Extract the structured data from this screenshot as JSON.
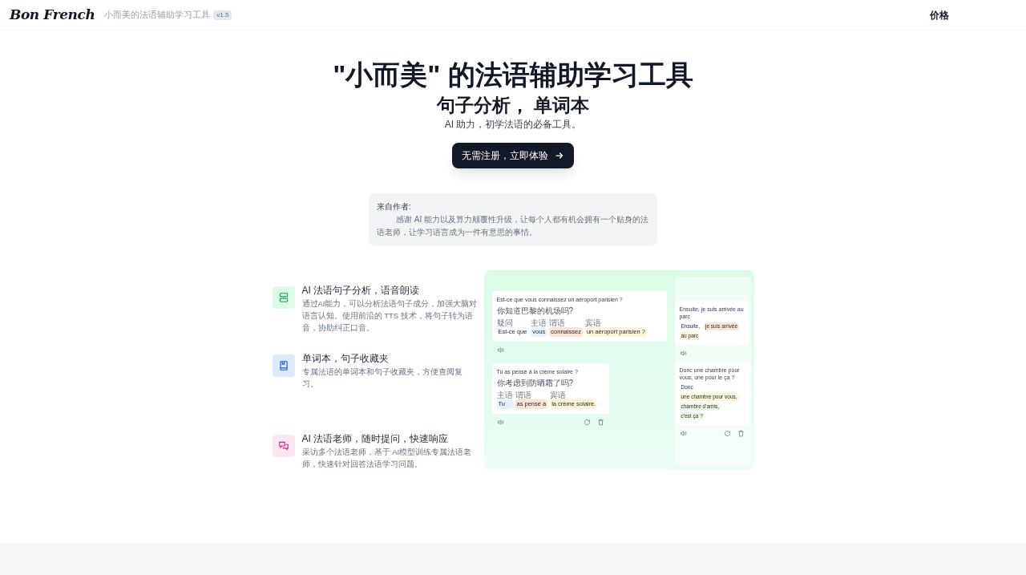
{
  "header": {
    "logo": "Bon French",
    "tagline": "小而美的法语辅助学习工具",
    "version": "v1.5",
    "nav": [
      {
        "label": "价格"
      }
    ]
  },
  "hero": {
    "title": "\"小而美\" 的法语辅助学习工具",
    "subtitle": "句子分析， 单词本",
    "description": "AI 助力，初学法语的必备工具。",
    "cta": "无需注册，立即体验"
  },
  "author_note": {
    "heading": "来自作者:",
    "body": "感谢 AI 能力以及算力颠覆性升级，让每个人都有机会拥有一个贴身的法语老师，让学习语言成为一件有意思的事情。"
  },
  "features": [
    {
      "kind": "analysis",
      "title": "AI 法语句子分析，语音朗读",
      "description": "通过AI能力，可以分析法语句子成分，加强大脑对语言认知。使用前沿的 TTS 技术，将句子转为语音，协助纠正口音。"
    },
    {
      "kind": "notebook",
      "title": "单词本，句子收藏夹",
      "description": "专属法语的单词本和句子收藏夹，方便查阅复习。"
    },
    {
      "kind": "chat",
      "title": "AI 法语老师，随时提问，快速响应",
      "description": "采访多个法语老师，基于 AI模型训练专属法语老师，快速针对回答法语学习问题。"
    }
  ],
  "preview": {
    "left_cards": [
      {
        "sentence": "Est-ce que vous connaissez un aéroport parisien ?",
        "translation": "你知道巴黎的机场吗?",
        "history_actions": false,
        "segments": [
          {
            "role": "疑问",
            "text": "Est-ce que",
            "color": "#ffffff"
          },
          {
            "role": "主语",
            "text": "vous",
            "color": "#e6f1fd"
          },
          {
            "role": "谓语",
            "text": "connaissez",
            "color": "#fde3d3"
          },
          {
            "role": "宾语",
            "text": "un aéroport parisien ?",
            "color": "#fef5d9"
          }
        ]
      },
      {
        "sentence": "Tu as pensé à la crème solaire ?",
        "translation": "你考虑到防晒霜了吗?",
        "history_actions": true,
        "segments": [
          {
            "role": "主语",
            "text": "Tu",
            "color": "#e6f1fd"
          },
          {
            "role": "谓语",
            "text": "as pensé à",
            "color": "#fde3d3"
          },
          {
            "role": "宾语",
            "text": "la crème solaire.",
            "color": "#fef5d9"
          }
        ]
      }
    ],
    "right_cards": [
      {
        "sentence": "Ensuite, je suis arrivée au parc",
        "history_actions": false,
        "segments": [
          {
            "text": "Ensuite,",
            "color": "#ffffff"
          },
          {
            "text": "je suis arrivée",
            "color": "#fde3d3"
          },
          {
            "text": "au parc",
            "color": "#fef5d9"
          }
        ]
      },
      {
        "sentence": "Donc une chambre pour vous, une pour le ça ?",
        "history_actions": true,
        "segments": [
          {
            "text": "Donc",
            "color": "#ffffff"
          },
          {
            "text": "une chambre pour vous,",
            "color": "#fef5d9"
          },
          {
            "text": "chambre d'amis,",
            "color": "#f0fbe6"
          },
          {
            "text": "c'est ça ?",
            "color": "#f0fbe6"
          }
        ]
      }
    ]
  }
}
